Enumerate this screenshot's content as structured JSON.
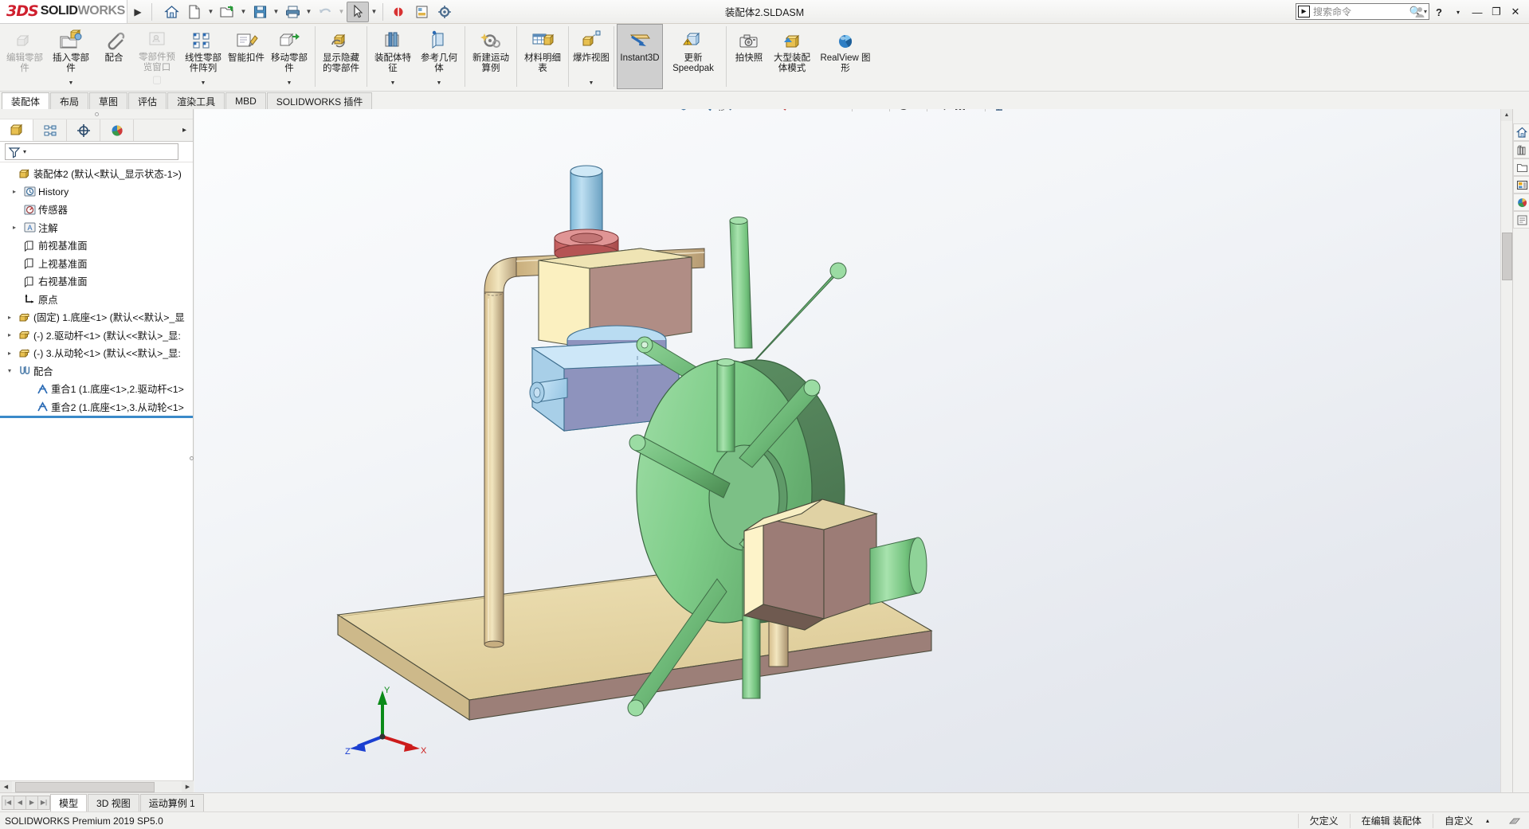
{
  "app": {
    "brand_3ds": "3DS",
    "brand_bold": "SOLID",
    "brand_light": "WORKS",
    "window_title": "装配体2.SLDASM",
    "version_status": "SOLIDWORKS Premium 2019 SP5.0"
  },
  "titlebar": {
    "expand_label": "▶",
    "quick_access": [
      {
        "name": "home-icon",
        "label": "主页",
        "caret": false
      },
      {
        "name": "new-document-icon",
        "label": "新建",
        "caret": true
      },
      {
        "name": "open-folder-icon",
        "label": "打开",
        "caret": true
      },
      {
        "name": "save-icon",
        "label": "保存",
        "caret": true
      },
      {
        "name": "print-icon",
        "label": "打印",
        "caret": true
      },
      {
        "name": "undo-icon",
        "label": "撤销",
        "caret": true
      },
      {
        "name": "select-arrow-icon",
        "label": "选择",
        "caret": true
      },
      {
        "name": "rebuild-icon",
        "label": "重建模型",
        "caret": false
      },
      {
        "name": "drawing-icon",
        "label": "工程图",
        "caret": false
      },
      {
        "name": "options-gear-icon",
        "label": "选项",
        "caret": false
      }
    ],
    "search": {
      "placeholder": "搜索命令",
      "caret": "▾"
    },
    "user_icon": "user-icon",
    "help_label": "?",
    "help_caret": "▾",
    "minimize": "—",
    "restore": "❐",
    "close": "✕"
  },
  "ribbon": {
    "items": [
      {
        "label": "编辑零部件",
        "icon": "edit-component-icon",
        "disabled": true,
        "dropdown": false
      },
      {
        "label": "插入零部件",
        "icon": "insert-component-icon",
        "disabled": false,
        "dropdown": true
      },
      {
        "label": "配合",
        "icon": "mate-paperclip-icon",
        "disabled": false,
        "dropdown": false
      },
      {
        "label": "零部件预览窗口",
        "icon": "component-preview-icon",
        "disabled": true,
        "dropdown": false
      },
      {
        "label": "线性零部件阵列",
        "icon": "linear-pattern-icon",
        "disabled": false,
        "dropdown": true
      },
      {
        "label": "智能扣件",
        "icon": "smart-fastener-icon",
        "disabled": false,
        "dropdown": false
      },
      {
        "label": "移动零部件",
        "icon": "move-component-icon",
        "disabled": false,
        "dropdown": true
      },
      {
        "sep": true
      },
      {
        "label": "显示隐藏的零部件",
        "icon": "show-hidden-components-icon",
        "disabled": false,
        "dropdown": false
      },
      {
        "sep": true
      },
      {
        "label": "装配体特征",
        "icon": "assembly-feature-icon",
        "disabled": false,
        "dropdown": true
      },
      {
        "label": "参考几何体",
        "icon": "reference-geometry-icon",
        "disabled": false,
        "dropdown": true
      },
      {
        "sep": true
      },
      {
        "label": "新建运动算例",
        "icon": "new-motion-study-icon",
        "disabled": false,
        "dropdown": false
      },
      {
        "sep": true
      },
      {
        "label": "材料明细表",
        "icon": "bill-of-materials-icon",
        "disabled": false,
        "dropdown": false
      },
      {
        "sep": true
      },
      {
        "label": "爆炸视图",
        "icon": "exploded-view-icon",
        "disabled": false,
        "dropdown": true
      },
      {
        "sep": true
      },
      {
        "label": "Instant3D",
        "icon": "instant3d-icon",
        "disabled": false,
        "dropdown": false,
        "active": true
      },
      {
        "label": "更新 Speedpak",
        "icon": "update-speedpak-icon",
        "disabled": false,
        "dropdown": false
      },
      {
        "sep": true
      },
      {
        "label": "拍快照",
        "icon": "snapshot-camera-icon",
        "disabled": false,
        "dropdown": false
      },
      {
        "label": "大型装配体模式",
        "icon": "large-assembly-mode-icon",
        "disabled": false,
        "dropdown": false
      },
      {
        "label": "RealView 图形",
        "icon": "realview-graphics-icon",
        "disabled": false,
        "dropdown": false
      }
    ]
  },
  "command_tabs": {
    "items": [
      "装配体",
      "布局",
      "草图",
      "评估",
      "渲染工具",
      "MBD",
      "SOLIDWORKS 插件"
    ],
    "active": "装配体"
  },
  "feature_manager": {
    "tabs": [
      {
        "name": "feature-manager-tab",
        "icon": "feature-tree-icon",
        "active": true
      },
      {
        "name": "property-manager-tab",
        "icon": "property-manager-icon",
        "active": false
      },
      {
        "name": "configuration-manager-tab",
        "icon": "configuration-icon",
        "active": false
      },
      {
        "name": "display-manager-tab",
        "icon": "display-manager-icon",
        "active": false
      }
    ],
    "more_caret": "▸",
    "filter_icon": "filter-funnel-icon",
    "filter_caret": "▾",
    "tree": [
      {
        "label": "装配体2  (默认<默认_显示状态-1>)",
        "icon": "assembly-icon",
        "arrow": "",
        "indent": 0
      },
      {
        "label": "History",
        "icon": "history-icon",
        "arrow": "▸",
        "indent": 1
      },
      {
        "label": "传感器",
        "icon": "sensors-icon",
        "arrow": "",
        "indent": 1
      },
      {
        "label": "注解",
        "icon": "annotations-icon",
        "arrow": "▸",
        "indent": 1
      },
      {
        "label": "前视基准面",
        "icon": "plane-icon",
        "arrow": "",
        "indent": 1
      },
      {
        "label": "上视基准面",
        "icon": "plane-icon",
        "arrow": "",
        "indent": 1
      },
      {
        "label": "右视基准面",
        "icon": "plane-icon",
        "arrow": "",
        "indent": 1
      },
      {
        "label": "原点",
        "icon": "origin-icon",
        "arrow": "",
        "indent": 1
      },
      {
        "label": "(固定) 1.底座<1> (默认<<默认>_显",
        "icon": "part-icon",
        "arrow": "▸",
        "indent": 0
      },
      {
        "label": "(-) 2.驱动杆<1> (默认<<默认>_显:",
        "icon": "part-icon",
        "arrow": "▸",
        "indent": 0
      },
      {
        "label": "(-) 3.从动轮<1> (默认<<默认>_显:",
        "icon": "part-icon",
        "arrow": "▸",
        "indent": 0
      },
      {
        "label": "配合",
        "icon": "mates-folder-icon",
        "arrow": "▾",
        "indent": 0
      },
      {
        "label": "重合1 (1.底座<1>,2.驱动杆<1>",
        "icon": "coincident-mate-icon",
        "arrow": "",
        "indent": 2
      },
      {
        "label": "重合2 (1.底座<1>,3.从动轮<1>",
        "icon": "coincident-mate-icon",
        "arrow": "",
        "indent": 2
      }
    ]
  },
  "view_toolbar": {
    "items": [
      {
        "name": "zoom-to-fit-icon",
        "caret": false
      },
      {
        "name": "zoom-to-area-icon",
        "caret": false
      },
      {
        "name": "previous-view-icon",
        "caret": false
      },
      {
        "name": "section-view-icon",
        "caret": false
      },
      {
        "name": "view-orientation-icon",
        "caret": false
      },
      {
        "name": "display-style-icon",
        "caret": false
      },
      {
        "name": "hide-show-items-icon",
        "caret": false
      },
      {
        "name": "apply-scene-icon",
        "caret": true
      },
      {
        "sep": true
      },
      {
        "name": "view-settings-icon",
        "caret": true
      },
      {
        "sep": true
      },
      {
        "name": "appearance-icon",
        "caret": false
      },
      {
        "sep": true
      },
      {
        "name": "edit-appearance-icon",
        "caret": true
      },
      {
        "sep": true
      },
      {
        "name": "display-screen-icon",
        "caret": true
      }
    ],
    "window_buttons": [
      "❐",
      "❏",
      "—",
      "▣",
      "✕"
    ]
  },
  "right_dock": {
    "items": [
      {
        "name": "solidworks-resources-icon"
      },
      {
        "name": "design-library-icon"
      },
      {
        "name": "file-explorer-icon"
      },
      {
        "name": "view-palette-icon"
      },
      {
        "name": "appearances-scenes-icon"
      },
      {
        "name": "custom-properties-icon"
      }
    ]
  },
  "model": {
    "triad": {
      "x_label": "X",
      "y_label": "Y",
      "z_label": "Z",
      "x_color": "#cc1b1b",
      "y_color": "#0a8a18",
      "z_color": "#1b3fd1"
    },
    "colors": {
      "base_plate": "#e8dcae",
      "rod_brass": "#e3d39e",
      "block_cream": "#fdf2c8",
      "block_mauve": "#b89494",
      "cyl_blue": "#a5cfe8",
      "ring_red": "#cf6b6b",
      "body_blue": "#b2d9f2",
      "body_slate": "#8e93bd",
      "wheel_green": "#86d68e",
      "wheel_dark_green": "#5c8f61",
      "pin_green": "#7fcb87"
    }
  },
  "bottom_tabs": {
    "nav": [
      "|◀",
      "◀",
      "▶",
      "▶|"
    ],
    "items": [
      "模型",
      "3D 视图",
      "运动算例 1"
    ],
    "active": "模型"
  },
  "status_bar": {
    "left": "SOLIDWORKS Premium 2019 SP5.0",
    "cells": [
      "欠定义",
      "在编辑 装配体",
      "自定义"
    ],
    "caret": "▴",
    "end_icon": "resize-grip-icon"
  }
}
